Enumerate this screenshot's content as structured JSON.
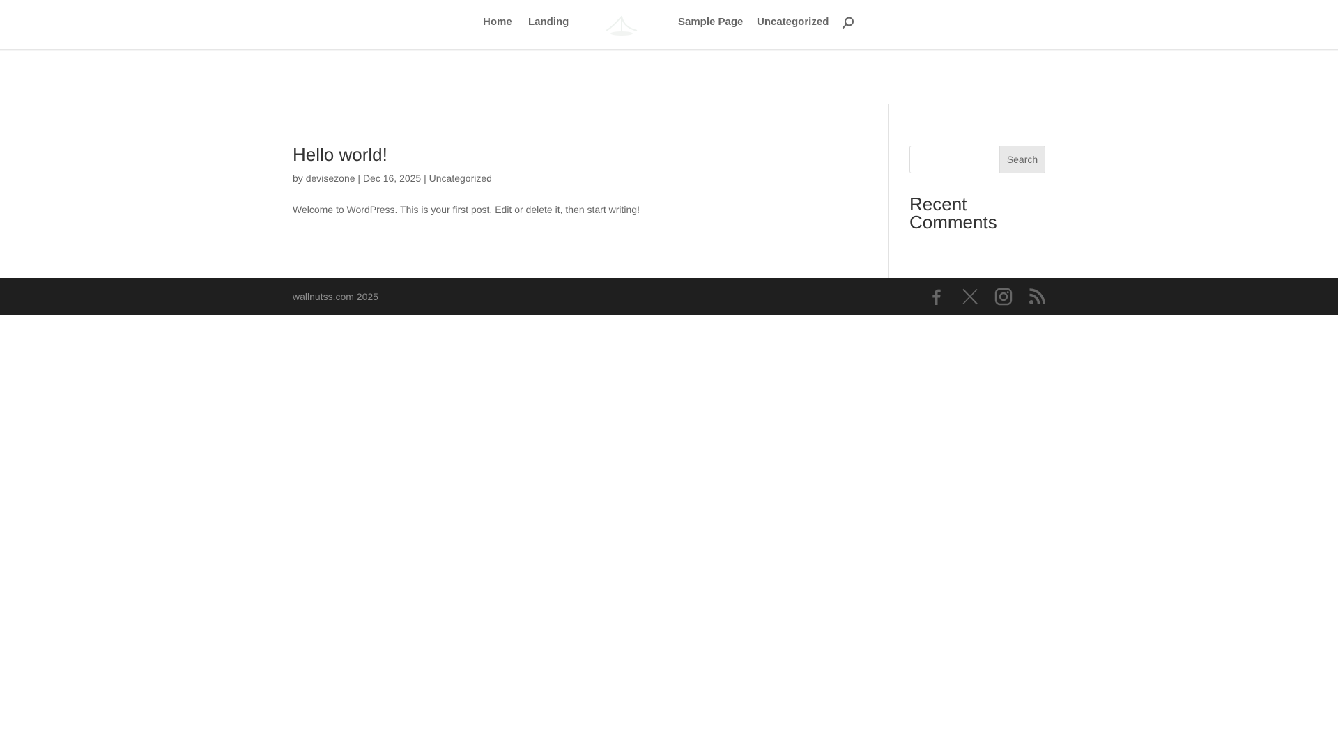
{
  "header": {
    "nav": [
      {
        "label": "Home"
      },
      {
        "label": "Landing"
      },
      {
        "label": "Sample Page"
      },
      {
        "label": "Uncategorized"
      }
    ],
    "logo_icon": "site-logo",
    "search_icon": "search-icon"
  },
  "post": {
    "title": "Hello world!",
    "meta": {
      "by": "by",
      "author": "devisezone",
      "separator": "|",
      "date": "Dec 16, 2025",
      "category": "Uncategorized"
    },
    "excerpt": "Welcome to WordPress. This is your first post. Edit or delete it, then start writing!"
  },
  "sidebar": {
    "search": {
      "placeholder": "",
      "value": "",
      "button_label": "Search"
    },
    "recent_comments_title": "Recent Comments"
  },
  "footer": {
    "credit": "wallnutss.com 2025",
    "social": [
      "facebook-icon",
      "x-icon",
      "instagram-icon",
      "rss-icon"
    ],
    "icon_color": "#666666",
    "background": "#1f1f1f"
  }
}
